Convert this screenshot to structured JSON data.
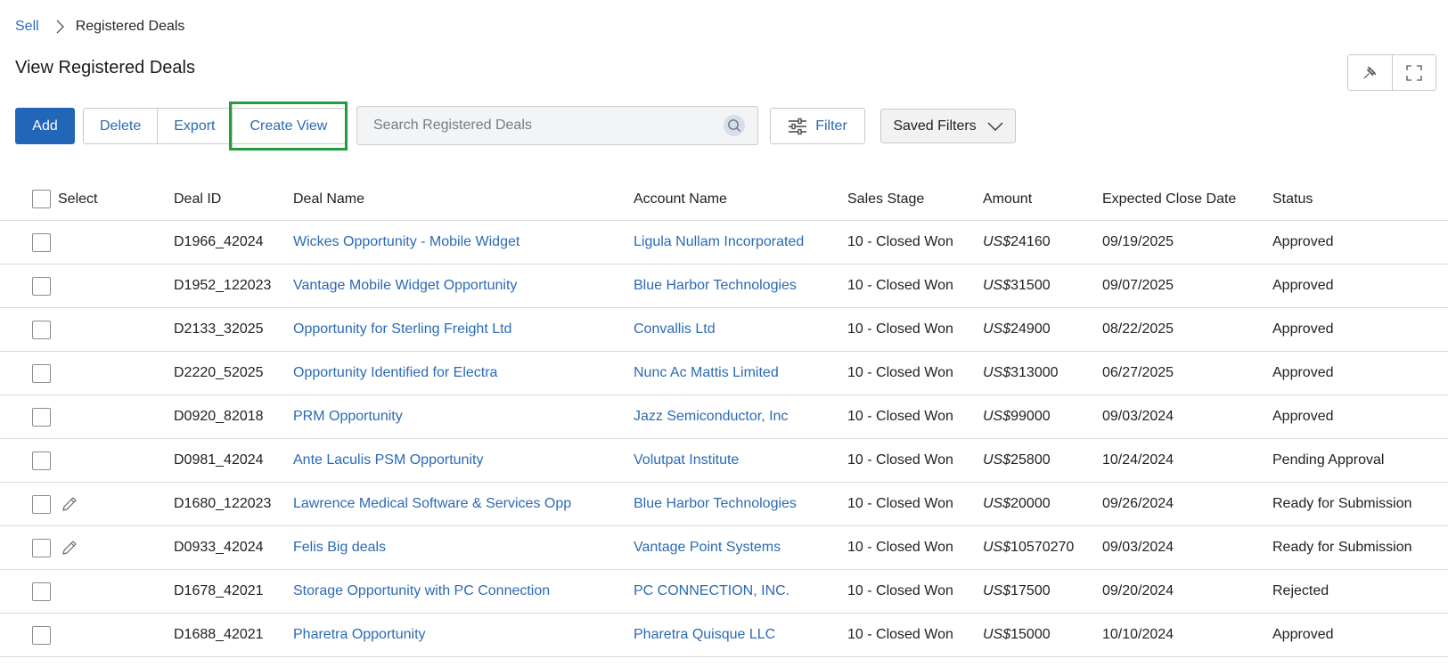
{
  "breadcrumb": {
    "parent": "Sell",
    "current": "Registered Deals"
  },
  "page": {
    "title": "View Registered Deals"
  },
  "toolbar": {
    "add_label": "Add",
    "delete_label": "Delete",
    "export_label": "Export",
    "create_view_label": "Create View",
    "search_placeholder": "Search Registered Deals",
    "filter_label": "Filter",
    "saved_filters_label": "Saved Filters"
  },
  "table": {
    "headers": {
      "select": "Select",
      "deal_id": "Deal ID",
      "deal_name": "Deal Name",
      "account_name": "Account Name",
      "sales_stage": "Sales Stage",
      "amount": "Amount",
      "expected_close_date": "Expected Close Date",
      "status": "Status"
    },
    "rows": [
      {
        "deal_id": "D1966_42024",
        "deal_name": "Wickes Opportunity - Mobile Widget",
        "account_name": "Ligula Nullam Incorporated",
        "sales_stage": "10 - Closed Won",
        "currency": "US$",
        "amount": "24160",
        "close_date": "09/19/2025",
        "status": "Approved",
        "editable": false
      },
      {
        "deal_id": "D1952_122023",
        "deal_name": "Vantage Mobile Widget Opportunity",
        "account_name": "Blue Harbor Technologies",
        "sales_stage": "10 - Closed Won",
        "currency": "US$",
        "amount": "31500",
        "close_date": "09/07/2025",
        "status": "Approved",
        "editable": false
      },
      {
        "deal_id": "D2133_32025",
        "deal_name": "Opportunity for Sterling Freight Ltd",
        "account_name": "Convallis Ltd",
        "sales_stage": "10 - Closed Won",
        "currency": "US$",
        "amount": "24900",
        "close_date": "08/22/2025",
        "status": "Approved",
        "editable": false
      },
      {
        "deal_id": "D2220_52025",
        "deal_name": "Opportunity Identified for Electra",
        "account_name": "Nunc Ac Mattis Limited",
        "sales_stage": "10 - Closed Won",
        "currency": "US$",
        "amount": "313000",
        "close_date": "06/27/2025",
        "status": "Approved",
        "editable": false
      },
      {
        "deal_id": "D0920_82018",
        "deal_name": "PRM Opportunity",
        "account_name": "Jazz Semiconductor, Inc",
        "sales_stage": "10 - Closed Won",
        "currency": "US$",
        "amount": "99000",
        "close_date": "09/03/2024",
        "status": "Approved",
        "editable": false
      },
      {
        "deal_id": "D0981_42024",
        "deal_name": "Ante Laculis PSM Opportunity",
        "account_name": "Volutpat Institute",
        "sales_stage": "10 - Closed Won",
        "currency": "US$",
        "amount": "25800",
        "close_date": "10/24/2024",
        "status": "Pending Approval",
        "editable": false
      },
      {
        "deal_id": "D1680_122023",
        "deal_name": "Lawrence Medical Software & Services Opp",
        "account_name": "Blue Harbor Technologies",
        "sales_stage": "10 - Closed Won",
        "currency": "US$",
        "amount": "20000",
        "close_date": "09/26/2024",
        "status": "Ready for Submission",
        "editable": true
      },
      {
        "deal_id": "D0933_42024",
        "deal_name": "Felis Big deals",
        "account_name": "Vantage Point Systems",
        "sales_stage": "10 - Closed Won",
        "currency": "US$",
        "amount": "10570270",
        "close_date": "09/03/2024",
        "status": "Ready for Submission",
        "editable": true
      },
      {
        "deal_id": "D1678_42021",
        "deal_name": "Storage Opportunity with PC Connection",
        "account_name": "PC CONNECTION, INC.",
        "sales_stage": "10 - Closed Won",
        "currency": "US$",
        "amount": "17500",
        "close_date": "09/20/2024",
        "status": "Rejected",
        "editable": false
      },
      {
        "deal_id": "D1688_42021",
        "deal_name": "Pharetra Opportunity",
        "account_name": "Pharetra Quisque LLC",
        "sales_stage": "10 - Closed Won",
        "currency": "US$",
        "amount": "15000",
        "close_date": "10/10/2024",
        "status": "Approved",
        "editable": false
      }
    ]
  },
  "colors": {
    "accent": "#2266b8",
    "link": "#2b6ab5",
    "highlight": "#1e9e3e",
    "border": "#d9d9d9"
  },
  "icons": [
    "chevron-right-icon",
    "pin-icon",
    "fullscreen-icon",
    "search-icon",
    "sliders-icon",
    "chevron-down-icon",
    "pencil-icon"
  ]
}
